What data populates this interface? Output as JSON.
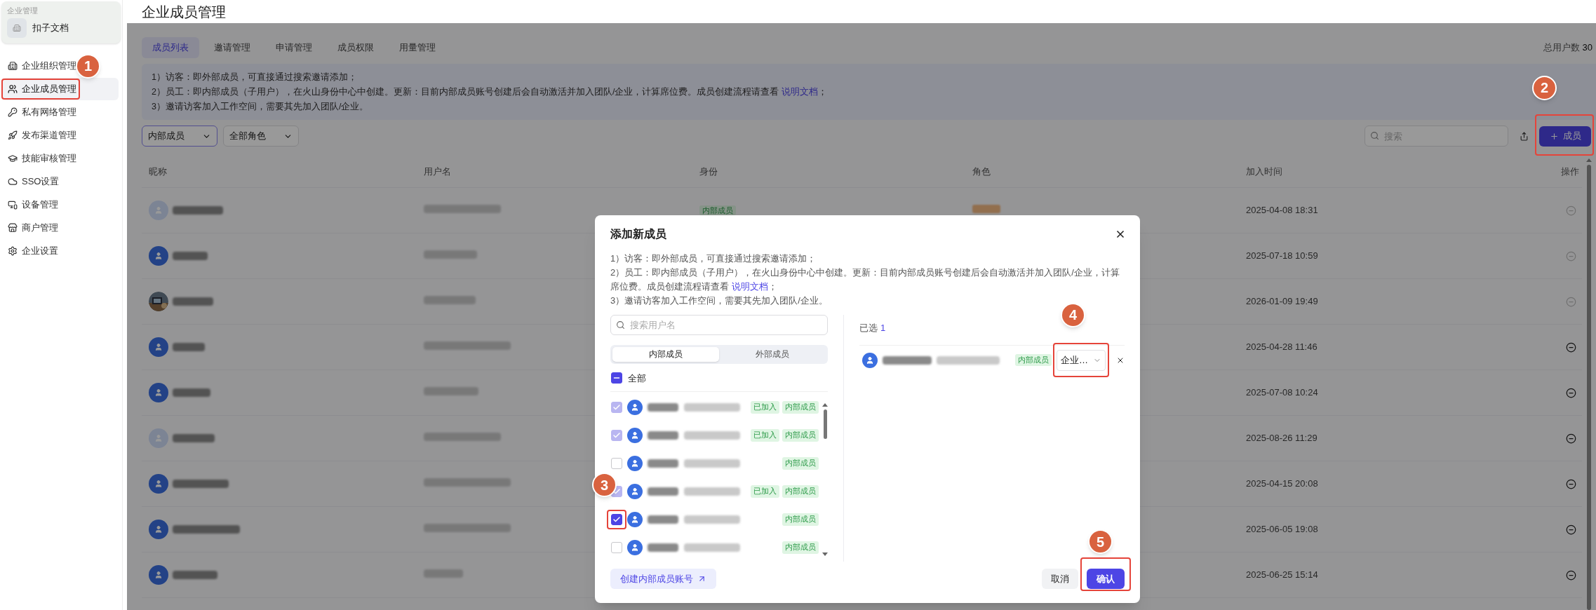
{
  "sidebar": {
    "section_label": "企业管理",
    "org_name": "扣子文档",
    "items": [
      {
        "label": "企业组织管理",
        "selected": false
      },
      {
        "label": "企业成员管理",
        "selected": true,
        "step": "1"
      },
      {
        "label": "私有网络管理",
        "selected": false
      },
      {
        "label": "发布渠道管理",
        "selected": false
      },
      {
        "label": "技能审核管理",
        "selected": false
      },
      {
        "label": "SSO设置",
        "selected": false
      },
      {
        "label": "设备管理",
        "selected": false
      },
      {
        "label": "商户管理",
        "selected": false
      },
      {
        "label": "企业设置",
        "selected": false
      }
    ]
  },
  "page_title": "企业成员管理",
  "tabs": [
    {
      "label": "成员列表",
      "selected": true
    },
    {
      "label": "邀请管理",
      "selected": false
    },
    {
      "label": "申请管理",
      "selected": false
    },
    {
      "label": "成员权限",
      "selected": false
    },
    {
      "label": "用量管理",
      "selected": false
    }
  ],
  "total_label": "总用户数",
  "total": "30",
  "notice": [
    {
      "text": "1）访客：即外部成员，可直接通过搜索邀请添加；"
    },
    {
      "text": "2）员工：即内部成员（子用户），在火山身份中心中创建。更新：目前内部成员账号创建后会自动激活并加入团队/企业，计算席位费。成员创建流程请查看 ",
      "link": "说明文档",
      "after": "；"
    },
    {
      "text": "3）邀请访客加入工作空间，需要其先加入团队/企业。"
    }
  ],
  "filters": [
    {
      "value": "内部成员",
      "active": true
    },
    {
      "value": "全部角色",
      "active": false
    }
  ],
  "search_placeholder": "搜索",
  "add_button": {
    "label": "成员",
    "step": "2"
  },
  "table": {
    "columns": [
      "昵称",
      "用户名",
      "身份",
      "角色",
      "加入时间",
      "操作"
    ],
    "rows": [
      {
        "kind": "faded",
        "identity": "内部成员",
        "has_role_tag": true,
        "joined": "2025-04-08 18:31",
        "disabled": true
      },
      {
        "kind": "user",
        "joined": "2025-07-18 10:59",
        "disabled": true
      },
      {
        "kind": "picture",
        "joined": "2026-01-09 19:49",
        "disabled": true
      },
      {
        "kind": "user",
        "joined": "2025-04-28 11:46",
        "disabled": false
      },
      {
        "kind": "user",
        "joined": "2025-07-08 10:24",
        "disabled": false
      },
      {
        "kind": "faded",
        "joined": "2025-08-26 11:29",
        "disabled": false
      },
      {
        "kind": "user",
        "joined": "2025-04-15 20:08",
        "disabled": false
      },
      {
        "kind": "user",
        "joined": "2025-06-05 19:08",
        "disabled": false
      },
      {
        "kind": "user",
        "joined": "2025-06-25 15:14",
        "disabled": false
      }
    ]
  },
  "dialog": {
    "title": "添加新成员",
    "notes": [
      {
        "text": "1）访客：即外部成员，可直接通过搜索邀请添加；"
      },
      {
        "text": "2）员工：即内部成员（子用户），在火山身份中心中创建。更新：目前内部成员账号创建后会自动激活并加入团队/企业，计算席位费。成员创建流程请查看 ",
        "link": "说明文档",
        "after": "；"
      },
      {
        "text": "3）邀请访客加入工作空间，需要其先加入团队/企业。"
      }
    ],
    "search_placeholder": "搜索用户名",
    "tabs": [
      {
        "label": "内部成员",
        "selected": true
      },
      {
        "label": "外部成员",
        "selected": false
      }
    ],
    "select_all": {
      "label": "全部",
      "indeterminate": true
    },
    "candidates": [
      {
        "checked": true,
        "disabled": true,
        "tags": [
          "已加入",
          "内部成员"
        ]
      },
      {
        "checked": true,
        "disabled": true,
        "tags": [
          "已加入",
          "内部成员"
        ]
      },
      {
        "checked": false,
        "disabled": false,
        "tags": [
          "内部成员"
        ]
      },
      {
        "checked": true,
        "disabled": true,
        "tags": [
          "已加入",
          "内部成员"
        ]
      },
      {
        "checked": true,
        "disabled": false,
        "tags": [
          "内部成员"
        ],
        "step": "3"
      },
      {
        "checked": false,
        "disabled": false,
        "tags": [
          "内部成员"
        ]
      }
    ],
    "selected_label": "已选",
    "selected_count": "1",
    "chosen": [
      {
        "tag": "内部成员",
        "role": "企业…",
        "step": "4"
      }
    ],
    "create_button": "创建内部成员账号",
    "cancel": "取消",
    "confirm": {
      "label": "确认",
      "step": "5"
    }
  }
}
